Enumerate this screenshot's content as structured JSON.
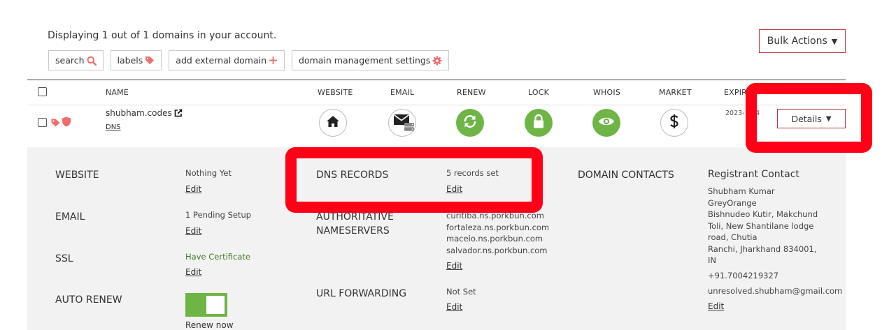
{
  "header": {
    "display_count": "Displaying 1 out of 1 domains in your account.",
    "bulk_actions_label": "Bulk Actions",
    "bulk_actions_caret": "▼"
  },
  "toolbar": {
    "search_label": "search",
    "labels_label": "labels",
    "add_external_label": "add external domain",
    "settings_label": "domain management settings"
  },
  "table": {
    "columns": [
      "NAME",
      "WEBSITE",
      "EMAIL",
      "RENEW",
      "LOCK",
      "WHOIS",
      "MARKET",
      "EXPIR"
    ],
    "row": {
      "domain": "shubham.codes",
      "dns_link": "DNS",
      "expiry": "2023-1…4",
      "details_label": "Details",
      "details_caret": "▼"
    }
  },
  "details": {
    "website": {
      "label": "WEBSITE",
      "value": "Nothing Yet",
      "edit": "Edit"
    },
    "email": {
      "label": "EMAIL",
      "value": "1 Pending Setup",
      "edit": "Edit"
    },
    "ssl": {
      "label": "SSL",
      "value": "Have Certificate",
      "edit": "Edit"
    },
    "auto_renew": {
      "label": "AUTO RENEW",
      "renew_now": "Renew now",
      "enabled": true
    },
    "dns_records": {
      "label": "DNS RECORDS",
      "value": "5 records set",
      "edit": "Edit"
    },
    "nameservers": {
      "label_line1": "AUTHORITATIVE",
      "label_line2": "NAMESERVERS",
      "values": [
        "curitiba.ns.porkbun.com",
        "fortaleza.ns.porkbun.com",
        "maceio.ns.porkbun.com",
        "salvador.ns.porkbun.com"
      ],
      "edit": "Edit"
    },
    "url_forwarding": {
      "label": "URL FORWARDING",
      "value": "Not Set",
      "edit": "Edit"
    },
    "domain_contacts": {
      "label": "DOMAIN CONTACTS"
    },
    "registrant": {
      "title": "Registrant Contact",
      "name": "Shubham Kumar",
      "org": "GreyOrange",
      "address": "Bishnudeo Kutir, Makchund Toli, New Shantilane lodge road, Chutia",
      "city": "Ranchi, Jharkhand 834001, IN",
      "phone": "+91.7004219327",
      "email": "unresolved.shubham@gmail.com",
      "edit": "Edit"
    }
  },
  "colors": {
    "accent_red": "#c0313a",
    "icon_pink": "#f06c6c",
    "status_green": "#6fb546",
    "annotation_red": "#ff0017"
  },
  "icons": {
    "search": "search-icon",
    "labels": "tag-icon",
    "add": "plus-icon",
    "settings": "gear-icon",
    "website": "home-icon",
    "email": "envelope-icon",
    "renew": "refresh-icon",
    "lock": "lock-icon",
    "whois": "eye-icon",
    "market": "dollar-icon"
  }
}
